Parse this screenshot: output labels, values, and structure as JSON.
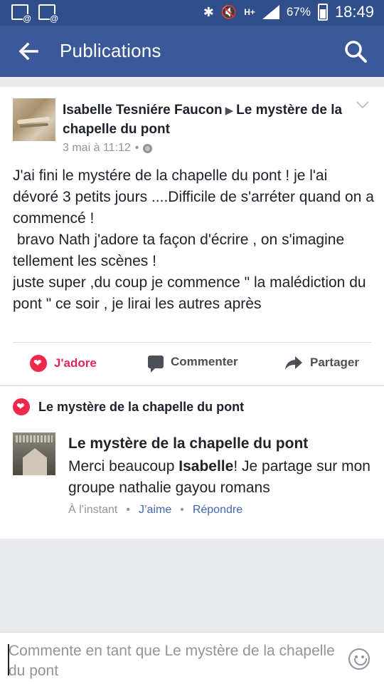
{
  "status_bar": {
    "battery_percent": "67%",
    "time": "18:49",
    "network": "H+"
  },
  "app_bar": {
    "title": "Publications"
  },
  "post": {
    "author": "Isabelle Tesniére Faucon",
    "target": "Le mystère de la chapelle du pont",
    "timestamp": "3 mai à 11:12",
    "separator": "•",
    "body": "J'ai fini le mystére de la chapelle du pont ! je l'ai dévoré 3 petits jours ....Difficile de s'arréter quand on a commencé !\n bravo Nath j'adore ta façon d'écrire , on s'imagine tellement les scènes !\njuste super ,du coup je commence \" la malédiction du pont \" ce soir , je lirai les autres après",
    "actions": {
      "love": "J'adore",
      "comment": "Commenter",
      "share": "Partager"
    }
  },
  "reactions": {
    "liked_by": "Le mystère de la chapelle du pont"
  },
  "comment": {
    "author": "Le mystère de la chapelle du pont",
    "text_before": "Merci beaucoup ",
    "text_bold": "Isabelle",
    "text_after": "! Je partage sur mon groupe nathalie gayou romans",
    "time": "À l’instant",
    "like": "J’aime",
    "reply": "Répondre",
    "dot": "•"
  },
  "composer": {
    "placeholder": "Commente en tant que Le mystère de la chapelle du pont"
  },
  "colors": {
    "status_bar": "#304e8a",
    "app_bar": "#3b5998",
    "love": "#e0245e",
    "link": "#4267b2",
    "meta_gray": "#90949c"
  }
}
